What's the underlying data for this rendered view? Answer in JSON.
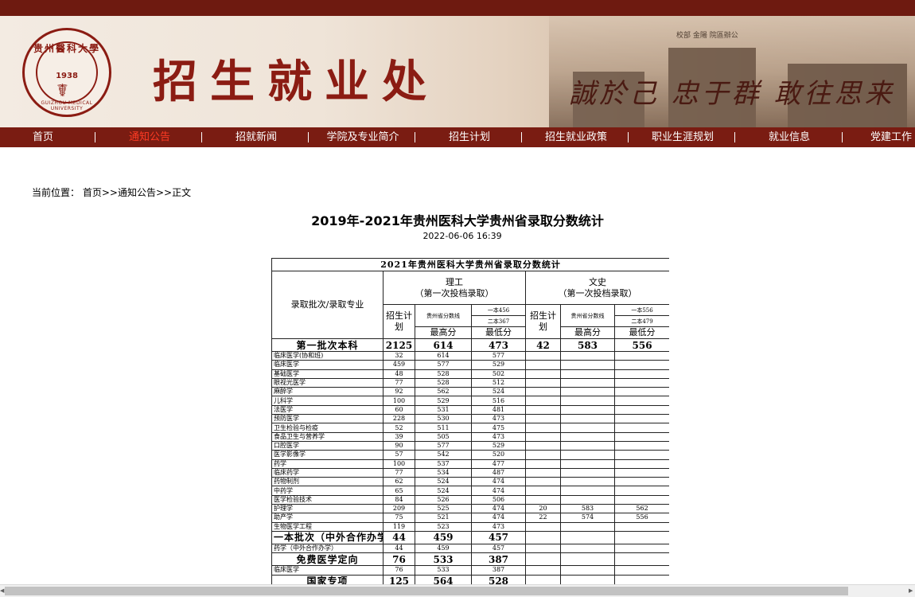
{
  "header": {
    "site_title": "招生就业处",
    "motto": "誠於己 忠于群 敢往思来",
    "logo": {
      "name_cn": "贵州醫科大學",
      "year": "1938",
      "name_en": "GUIZHOU MEDICAL UNIVERSITY"
    },
    "photo_sign": "校部 金陽 院區辦公"
  },
  "nav": {
    "items": [
      {
        "label": "首页"
      },
      {
        "label": "通知公告"
      },
      {
        "label": "招就新闻"
      },
      {
        "label": "学院及专业简介"
      },
      {
        "label": "招生计划"
      },
      {
        "label": "招生就业政策"
      },
      {
        "label": "职业生涯规划"
      },
      {
        "label": "就业信息"
      },
      {
        "label": "党建工作"
      }
    ],
    "separator": "|",
    "active_color": "#ff3b24",
    "bar_color": "#7a1c12"
  },
  "breadcrumb": {
    "label": "当前位置：",
    "path": "首页>>通知公告>>正文"
  },
  "article": {
    "title": "2019年-2021年贵州医科大学贵州省录取分数统计",
    "date": "2022-06-06 16:39"
  },
  "table": {
    "title": "2021年贵州医科大学贵州省录取分数统计",
    "col_major": "录取批次/录取专业",
    "group_science": "理工",
    "group_science_sub": "（第一次投档录取）",
    "group_arts": "文史",
    "group_arts_sub": "（第一次投档录取）",
    "plan": "招生计划",
    "prov_line": "贵州省分数线",
    "sci_line1": "一本456",
    "sci_line2": "二本367",
    "arts_line1": "一本556",
    "arts_line2": "二本479",
    "max": "最高分",
    "min": "最低分",
    "rows": [
      {
        "batch": true,
        "name": "第一批次本科",
        "s_plan": "2125",
        "s_max": "614",
        "s_min": "473",
        "a_plan": "42",
        "a_max": "583",
        "a_min": "556"
      },
      {
        "name": "临床医学(协和班)",
        "s_plan": "32",
        "s_max": "614",
        "s_min": "577"
      },
      {
        "name": "临床医学",
        "s_plan": "459",
        "s_max": "577",
        "s_min": "529"
      },
      {
        "name": "基础医学",
        "s_plan": "48",
        "s_max": "528",
        "s_min": "502"
      },
      {
        "name": "眼视光医学",
        "s_plan": "77",
        "s_max": "528",
        "s_min": "512"
      },
      {
        "name": "麻醉学",
        "s_plan": "92",
        "s_max": "562",
        "s_min": "524"
      },
      {
        "name": "儿科学",
        "s_plan": "100",
        "s_max": "529",
        "s_min": "516"
      },
      {
        "name": "法医学",
        "s_plan": "60",
        "s_max": "531",
        "s_min": "481"
      },
      {
        "name": "预防医学",
        "s_plan": "228",
        "s_max": "530",
        "s_min": "473"
      },
      {
        "name": "卫生检验与检疫",
        "s_plan": "52",
        "s_max": "511",
        "s_min": "475"
      },
      {
        "name": "食品卫生与营养学",
        "s_plan": "39",
        "s_max": "505",
        "s_min": "473"
      },
      {
        "name": "口腔医学",
        "s_plan": "90",
        "s_max": "577",
        "s_min": "529"
      },
      {
        "name": "医学影像学",
        "s_plan": "57",
        "s_max": "542",
        "s_min": "520"
      },
      {
        "name": "药学",
        "s_plan": "100",
        "s_max": "537",
        "s_min": "477"
      },
      {
        "name": "临床药学",
        "s_plan": "77",
        "s_max": "534",
        "s_min": "487"
      },
      {
        "name": "药物制剂",
        "s_plan": "62",
        "s_max": "524",
        "s_min": "474"
      },
      {
        "name": "中药学",
        "s_plan": "65",
        "s_max": "524",
        "s_min": "474"
      },
      {
        "name": "医学检验技术",
        "s_plan": "84",
        "s_max": "526",
        "s_min": "506"
      },
      {
        "name": "护理学",
        "s_plan": "209",
        "s_max": "525",
        "s_min": "474",
        "a_plan": "20",
        "a_max": "583",
        "a_min": "562"
      },
      {
        "name": "助产学",
        "s_plan": "75",
        "s_max": "521",
        "s_min": "474",
        "a_plan": "22",
        "a_max": "574",
        "a_min": "556"
      },
      {
        "name": "生物医学工程",
        "s_plan": "119",
        "s_max": "523",
        "s_min": "473"
      },
      {
        "batch": true,
        "name": "一本批次（中外合作办学）",
        "s_plan": "44",
        "s_max": "459",
        "s_min": "457"
      },
      {
        "name": "药学（中外合作办学）",
        "s_plan": "44",
        "s_max": "459",
        "s_min": "457"
      },
      {
        "batch": true,
        "name": "免费医学定向",
        "s_plan": "76",
        "s_max": "533",
        "s_min": "387"
      },
      {
        "name": "临床医学",
        "s_plan": "76",
        "s_max": "533",
        "s_min": "387"
      },
      {
        "batch": true,
        "name": "国家专项",
        "s_plan": "125",
        "s_max": "564",
        "s_min": "528"
      }
    ]
  }
}
